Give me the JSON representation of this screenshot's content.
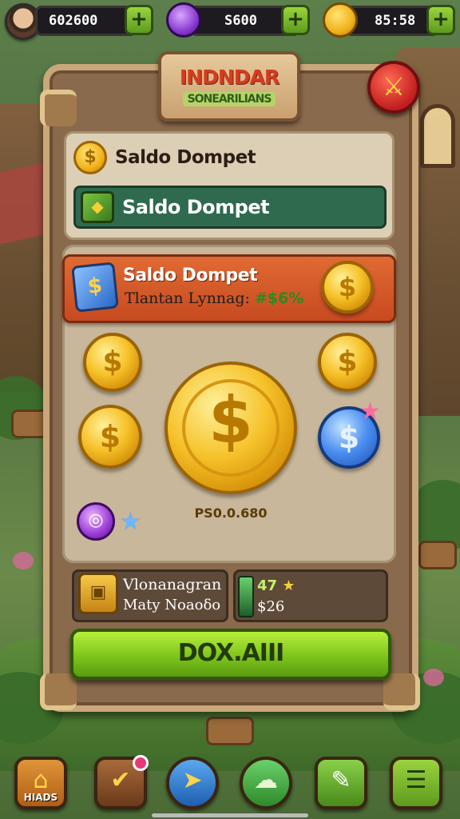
{
  "topbar": {
    "resources": [
      {
        "name": "coins",
        "value": "602600",
        "icon": "avatar-icon"
      },
      {
        "name": "gems",
        "value": "S600",
        "icon": "purple-gem-icon"
      },
      {
        "name": "gold",
        "value": "85:58",
        "icon": "gold-coin-icon"
      }
    ],
    "plus_label": "+"
  },
  "panel": {
    "title_line1": "INDNDAR",
    "title_line2": "SONEARILIANS",
    "close_icon": "sword-icon"
  },
  "balance": {
    "row1_label": "Saldo Dompet",
    "row2_label": "Saldo Dompet",
    "coin_symbol": "$"
  },
  "rate": {
    "title": "Saldo Dompet",
    "line_prefix": "Tlantan Lynnag:",
    "line_value": "#$6%"
  },
  "coins": {
    "symbol": "$",
    "big_amount": "PS0.0.680"
  },
  "info": {
    "left_line1": "Vlonanagran",
    "left_line2": "Maty Noaoδo",
    "right_line1": "47",
    "right_line2": "$26"
  },
  "claim_button": {
    "label": "DOX.AIII"
  },
  "nav": {
    "items": [
      {
        "icon": "home-icon",
        "label": "HIADS",
        "glyph": "⌂"
      },
      {
        "icon": "shield-icon",
        "label": "",
        "glyph": "✔"
      },
      {
        "icon": "arrow-icon",
        "label": "",
        "glyph": "➤"
      },
      {
        "icon": "chat-icon",
        "label": "",
        "glyph": "☁"
      },
      {
        "icon": "edit-icon",
        "label": "",
        "glyph": "✎"
      },
      {
        "icon": "menu-icon",
        "label": "",
        "glyph": "☰"
      }
    ]
  },
  "colors": {
    "button_green": "#78c11a",
    "rate_orange": "#e06a33",
    "balance_teal": "#2f6a4f",
    "close_red": "#c21e1e"
  }
}
